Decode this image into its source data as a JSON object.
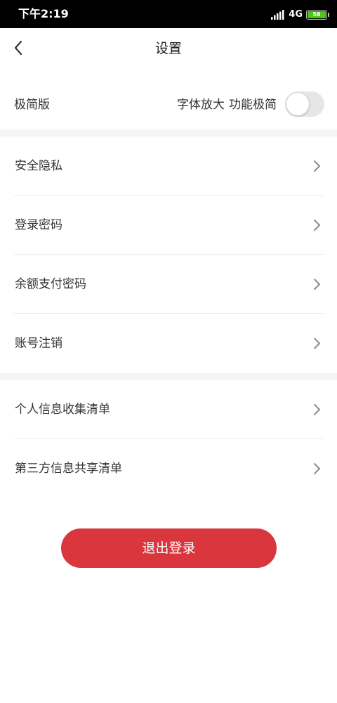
{
  "status_bar": {
    "time": "下午2:19",
    "network": "4G",
    "battery": "58",
    "icons": [
      "signal-icon",
      "battery-icon"
    ]
  },
  "nav": {
    "back_icon": "chevron-left-icon",
    "title": "设置"
  },
  "mode": {
    "label": "极简版",
    "desc_1": "字体放大",
    "desc_2": "功能极简",
    "toggle_on": false
  },
  "group1": {
    "items": [
      {
        "label": "安全隐私",
        "icon": "chevron-right-icon"
      },
      {
        "label": "登录密码",
        "icon": "chevron-right-icon"
      },
      {
        "label": "余额支付密码",
        "icon": "chevron-right-icon"
      },
      {
        "label": "账号注销",
        "icon": "chevron-right-icon"
      }
    ]
  },
  "group2": {
    "items": [
      {
        "label": "个人信息收集清单",
        "icon": "chevron-right-icon"
      },
      {
        "label": "第三方信息共享清单",
        "icon": "chevron-right-icon"
      }
    ]
  },
  "logout_label": "退出登录",
  "colors": {
    "accent": "#d9363e",
    "status_bar_bg": "#000000",
    "section_gap": "#f5f5f5",
    "toggle_off": "#e6e6e6",
    "battery": "#52c41a"
  }
}
